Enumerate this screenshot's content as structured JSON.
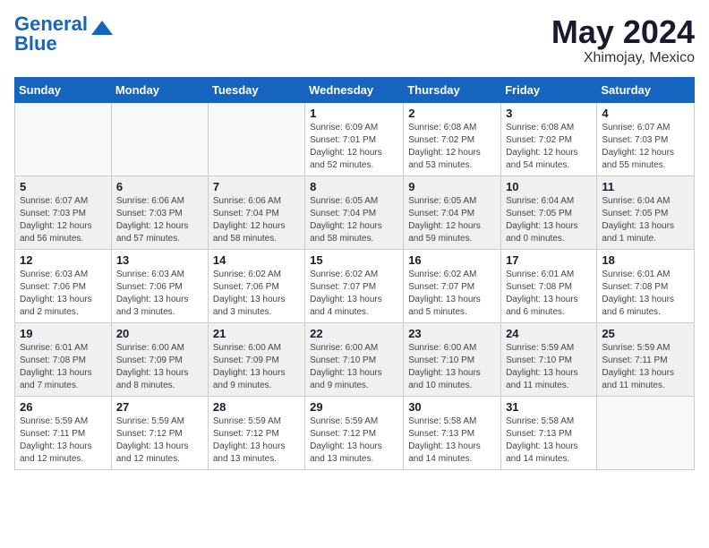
{
  "header": {
    "logo_line1": "General",
    "logo_line2": "Blue",
    "month": "May 2024",
    "location": "Xhimojay, Mexico"
  },
  "weekdays": [
    "Sunday",
    "Monday",
    "Tuesday",
    "Wednesday",
    "Thursday",
    "Friday",
    "Saturday"
  ],
  "weeks": [
    [
      {
        "day": "",
        "info": ""
      },
      {
        "day": "",
        "info": ""
      },
      {
        "day": "",
        "info": ""
      },
      {
        "day": "1",
        "info": "Sunrise: 6:09 AM\nSunset: 7:01 PM\nDaylight: 12 hours\nand 52 minutes."
      },
      {
        "day": "2",
        "info": "Sunrise: 6:08 AM\nSunset: 7:02 PM\nDaylight: 12 hours\nand 53 minutes."
      },
      {
        "day": "3",
        "info": "Sunrise: 6:08 AM\nSunset: 7:02 PM\nDaylight: 12 hours\nand 54 minutes."
      },
      {
        "day": "4",
        "info": "Sunrise: 6:07 AM\nSunset: 7:03 PM\nDaylight: 12 hours\nand 55 minutes."
      }
    ],
    [
      {
        "day": "5",
        "info": "Sunrise: 6:07 AM\nSunset: 7:03 PM\nDaylight: 12 hours\nand 56 minutes."
      },
      {
        "day": "6",
        "info": "Sunrise: 6:06 AM\nSunset: 7:03 PM\nDaylight: 12 hours\nand 57 minutes."
      },
      {
        "day": "7",
        "info": "Sunrise: 6:06 AM\nSunset: 7:04 PM\nDaylight: 12 hours\nand 58 minutes."
      },
      {
        "day": "8",
        "info": "Sunrise: 6:05 AM\nSunset: 7:04 PM\nDaylight: 12 hours\nand 58 minutes."
      },
      {
        "day": "9",
        "info": "Sunrise: 6:05 AM\nSunset: 7:04 PM\nDaylight: 12 hours\nand 59 minutes."
      },
      {
        "day": "10",
        "info": "Sunrise: 6:04 AM\nSunset: 7:05 PM\nDaylight: 13 hours\nand 0 minutes."
      },
      {
        "day": "11",
        "info": "Sunrise: 6:04 AM\nSunset: 7:05 PM\nDaylight: 13 hours\nand 1 minute."
      }
    ],
    [
      {
        "day": "12",
        "info": "Sunrise: 6:03 AM\nSunset: 7:06 PM\nDaylight: 13 hours\nand 2 minutes."
      },
      {
        "day": "13",
        "info": "Sunrise: 6:03 AM\nSunset: 7:06 PM\nDaylight: 13 hours\nand 3 minutes."
      },
      {
        "day": "14",
        "info": "Sunrise: 6:02 AM\nSunset: 7:06 PM\nDaylight: 13 hours\nand 3 minutes."
      },
      {
        "day": "15",
        "info": "Sunrise: 6:02 AM\nSunset: 7:07 PM\nDaylight: 13 hours\nand 4 minutes."
      },
      {
        "day": "16",
        "info": "Sunrise: 6:02 AM\nSunset: 7:07 PM\nDaylight: 13 hours\nand 5 minutes."
      },
      {
        "day": "17",
        "info": "Sunrise: 6:01 AM\nSunset: 7:08 PM\nDaylight: 13 hours\nand 6 minutes."
      },
      {
        "day": "18",
        "info": "Sunrise: 6:01 AM\nSunset: 7:08 PM\nDaylight: 13 hours\nand 6 minutes."
      }
    ],
    [
      {
        "day": "19",
        "info": "Sunrise: 6:01 AM\nSunset: 7:08 PM\nDaylight: 13 hours\nand 7 minutes."
      },
      {
        "day": "20",
        "info": "Sunrise: 6:00 AM\nSunset: 7:09 PM\nDaylight: 13 hours\nand 8 minutes."
      },
      {
        "day": "21",
        "info": "Sunrise: 6:00 AM\nSunset: 7:09 PM\nDaylight: 13 hours\nand 9 minutes."
      },
      {
        "day": "22",
        "info": "Sunrise: 6:00 AM\nSunset: 7:10 PM\nDaylight: 13 hours\nand 9 minutes."
      },
      {
        "day": "23",
        "info": "Sunrise: 6:00 AM\nSunset: 7:10 PM\nDaylight: 13 hours\nand 10 minutes."
      },
      {
        "day": "24",
        "info": "Sunrise: 5:59 AM\nSunset: 7:10 PM\nDaylight: 13 hours\nand 11 minutes."
      },
      {
        "day": "25",
        "info": "Sunrise: 5:59 AM\nSunset: 7:11 PM\nDaylight: 13 hours\nand 11 minutes."
      }
    ],
    [
      {
        "day": "26",
        "info": "Sunrise: 5:59 AM\nSunset: 7:11 PM\nDaylight: 13 hours\nand 12 minutes."
      },
      {
        "day": "27",
        "info": "Sunrise: 5:59 AM\nSunset: 7:12 PM\nDaylight: 13 hours\nand 12 minutes."
      },
      {
        "day": "28",
        "info": "Sunrise: 5:59 AM\nSunset: 7:12 PM\nDaylight: 13 hours\nand 13 minutes."
      },
      {
        "day": "29",
        "info": "Sunrise: 5:59 AM\nSunset: 7:12 PM\nDaylight: 13 hours\nand 13 minutes."
      },
      {
        "day": "30",
        "info": "Sunrise: 5:58 AM\nSunset: 7:13 PM\nDaylight: 13 hours\nand 14 minutes."
      },
      {
        "day": "31",
        "info": "Sunrise: 5:58 AM\nSunset: 7:13 PM\nDaylight: 13 hours\nand 14 minutes."
      },
      {
        "day": "",
        "info": ""
      }
    ]
  ]
}
